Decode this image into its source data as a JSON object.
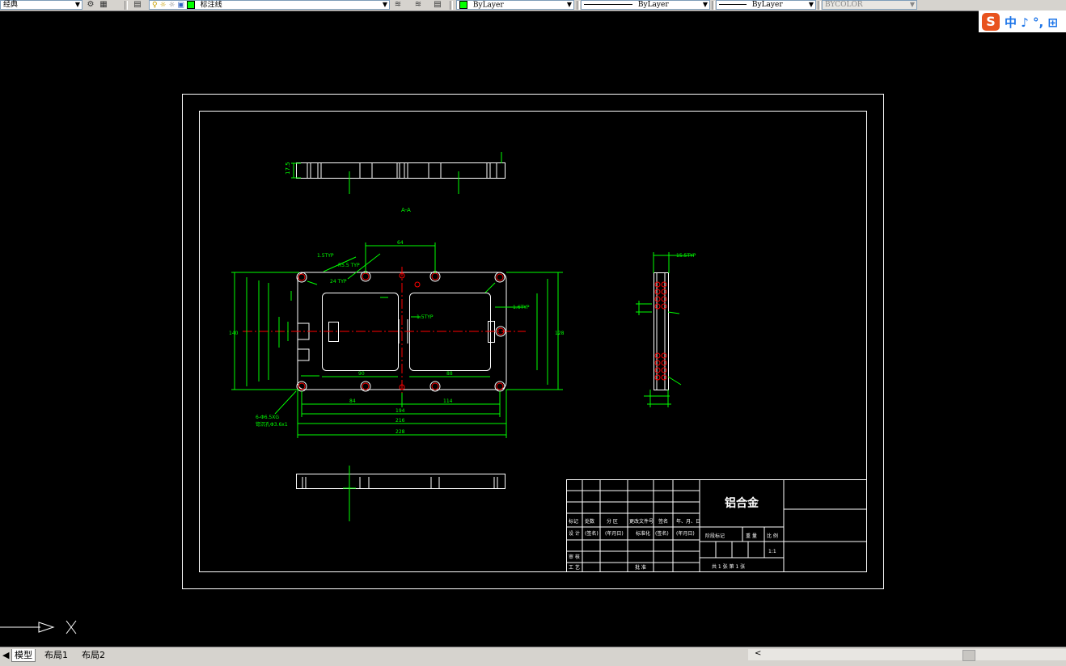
{
  "toolbar": {
    "style_combo": "经典",
    "layer_combo": "标注线",
    "color_combo": "ByLayer",
    "linetype_combo": "ByLayer",
    "lineweight_combo": "ByLayer",
    "plotstyle_combo": "BYCOLOR"
  },
  "ime": {
    "logo": "S",
    "indicators": "中 ♪ °, ⊞"
  },
  "colors": {
    "drawing_green": "#00ff00",
    "outline_white": "#ffffff",
    "center_red": "#ff0000",
    "hole_red": "#ff0000",
    "accent_orange": "#e8531e"
  },
  "drawing": {
    "section_label": "A-A",
    "title_block": {
      "material": "铝合金",
      "row_headers": [
        "标记",
        "处数",
        "分 区",
        "更改文件号",
        "签名",
        "年、月、日"
      ],
      "row2": [
        "设 计",
        "(签名)",
        "(年月日)",
        "标准化",
        "(签名)",
        "(年月日)"
      ],
      "right_headers": [
        "阶段标记",
        "重 量",
        "比 例"
      ],
      "scale": "1:1",
      "review": "审 核",
      "process": "工 艺",
      "approve": "批 准",
      "sheets": "共 1 张    第 1 张"
    },
    "dims": {
      "top_view_left": "17.5",
      "d_64": "64",
      "d_84": "84",
      "d_90": "90",
      "d_88": "88",
      "d_114": "114",
      "d_194": "194",
      "d_228": "228",
      "d_216": "216",
      "d_140": "140",
      "d_128": "128",
      "typ1": "1.5TYP",
      "typ2": "R5.5 TYP",
      "typ3": "24 TYP",
      "typ4": "1.6TYP",
      "typ5": "1.5TYP",
      "typ6": "15.5TYP",
      "hole_note": "6-Φ6.5XG",
      "hole_note2": "锪沉孔Φ3.6x1"
    }
  },
  "tabs": {
    "model": "模型",
    "layout1": "布局1",
    "layout2": "布局2"
  }
}
